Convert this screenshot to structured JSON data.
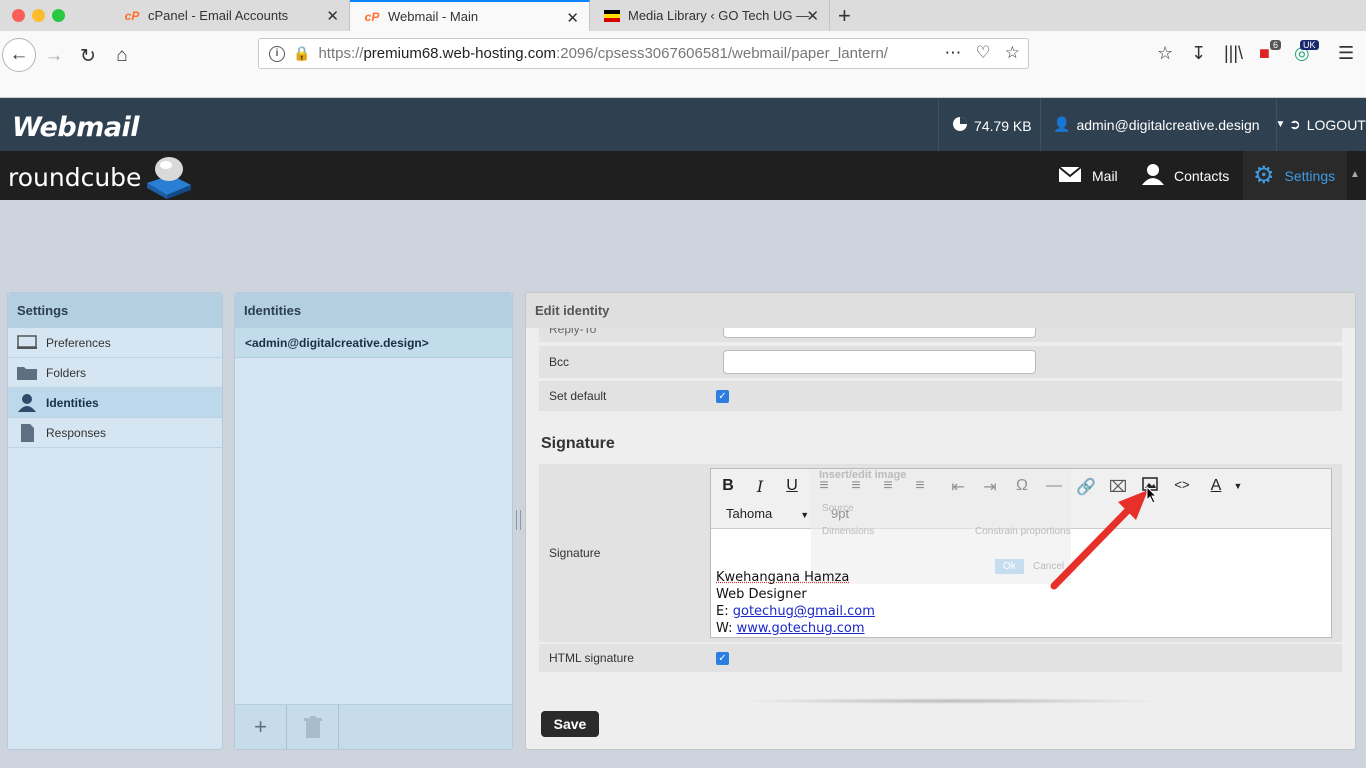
{
  "browser": {
    "tabs": [
      {
        "title": "cPanel - Email Accounts",
        "favicon": "cp"
      },
      {
        "title": "Webmail - Main",
        "favicon": "cp"
      },
      {
        "title": "Media Library ‹ GO Tech UG —",
        "favicon": "flag"
      }
    ],
    "url_host": "premium68.web-hosting.com",
    "url_prefix": "https://",
    "url_rest": ":2096/cpsess3067606581/webmail/paper_lantern/",
    "badge_count": "6",
    "badge_uk": "UK"
  },
  "header": {
    "logo": "Webmail",
    "quota": "74.79 KB",
    "user": "admin@digitalcreative.design",
    "logout": "LOGOUT"
  },
  "roundcube": {
    "logo": "roundcube",
    "nav": [
      {
        "label": "Mail",
        "icon": "envelope-icon"
      },
      {
        "label": "Contacts",
        "icon": "user-icon"
      },
      {
        "label": "Settings",
        "icon": "gear-icon"
      }
    ]
  },
  "settings": {
    "title": "Settings",
    "items": [
      {
        "label": "Preferences",
        "icon": "monitor-icon"
      },
      {
        "label": "Folders",
        "icon": "folder-icon"
      },
      {
        "label": "Identities",
        "icon": "person-icon"
      },
      {
        "label": "Responses",
        "icon": "document-icon"
      }
    ]
  },
  "identities": {
    "title": "Identities",
    "items": [
      "<admin@digitalcreative.design>"
    ]
  },
  "edit": {
    "title": "Edit identity",
    "partial_label": "Reply-To",
    "bcc_label": "Bcc",
    "bcc_value": "",
    "set_default_label": "Set default",
    "signature_heading": "Signature",
    "signature_label": "Signature",
    "html_signature_label": "HTML signature",
    "save": "Save",
    "font": "Tahoma",
    "font_size": "9pt",
    "ghost_dialog_title": "Insert/edit image",
    "ghost_source": "Source",
    "ghost_dimensions": "Dimensions",
    "ghost_constrain": "Constrain proportions",
    "ghost_ok": "Ok",
    "ghost_cancel": "Cancel",
    "signature": {
      "name": "Kwehangana Hamza",
      "title": "Web Designer",
      "email_prefix": "E: ",
      "email": "gotechug@gmail.com",
      "web_prefix": "W: ",
      "web": "www.gotechug.com"
    }
  },
  "colors": {
    "accent": "#3f9be3",
    "header": "#2f4050",
    "arrow": "#e8302a"
  }
}
